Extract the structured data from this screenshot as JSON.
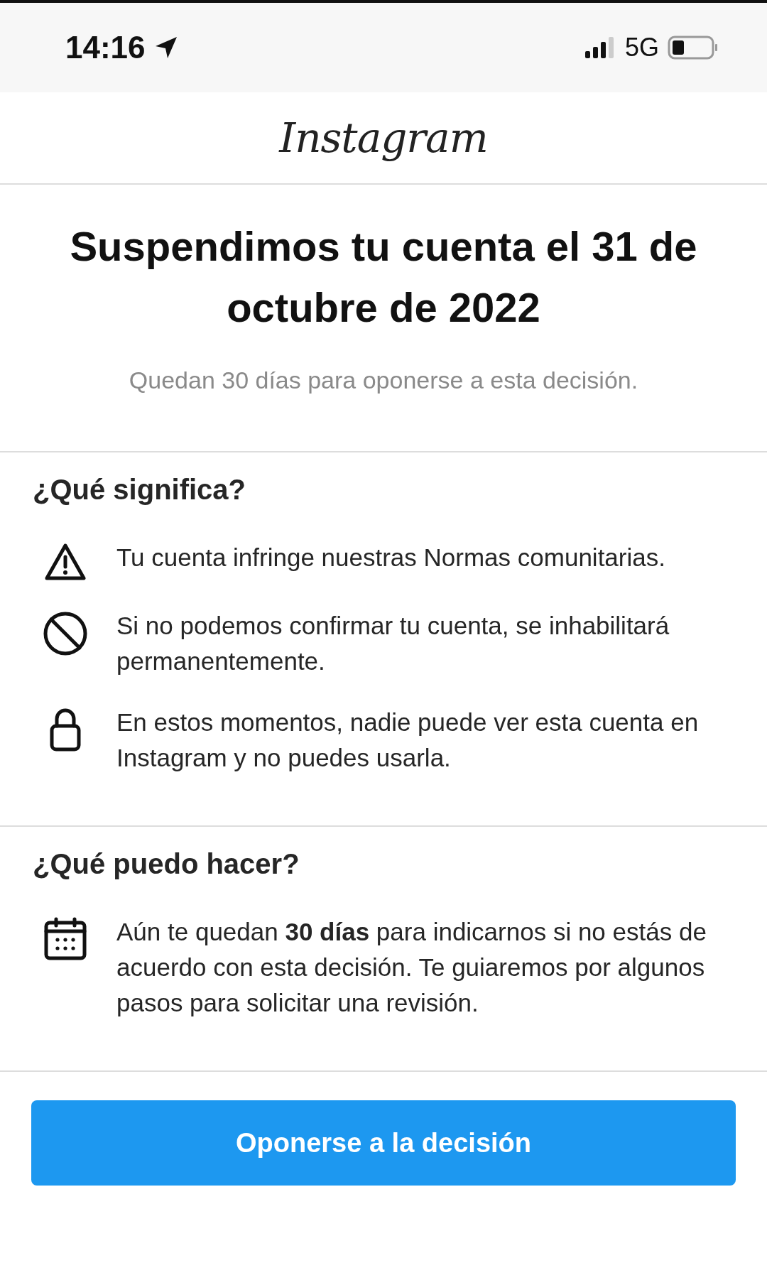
{
  "status_bar": {
    "time": "14:16",
    "network": "5G"
  },
  "header": {
    "logo": "Instagram"
  },
  "notice": {
    "title": "Suspendimos tu cuenta el 31 de octubre de 2022",
    "subtitle": "Quedan 30 días para oponerse a esta decisión."
  },
  "sections": [
    {
      "heading": "¿Qué significa?",
      "items": [
        {
          "kind": "warning",
          "text": "Tu cuenta infringe nuestras Normas comunitarias."
        },
        {
          "kind": "blocked",
          "text": "Si no podemos confirmar tu cuenta, se inhabilitará permanentemente."
        },
        {
          "kind": "lock",
          "text": "En estos momentos, nadie puede ver esta cuenta en Instagram y no puedes usarla."
        }
      ]
    },
    {
      "heading": "¿Qué puedo hacer?",
      "items": [
        {
          "kind": "calendar",
          "text": "Aún te quedan **30 días** para indicarnos si no estás de acuerdo con esta decisión. Te guiaremos por algunos pasos para solicitar una revisión."
        }
      ]
    }
  ],
  "button": {
    "label": "Oponerse a la decisión"
  }
}
